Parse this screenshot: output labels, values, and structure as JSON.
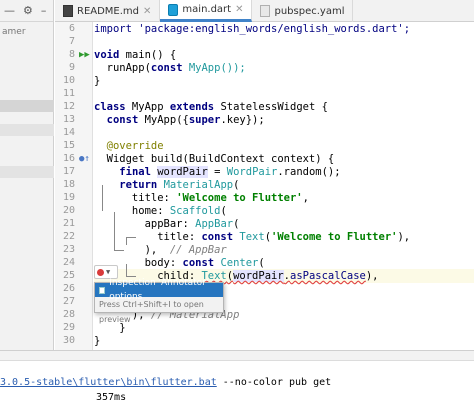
{
  "project_panel": {
    "toolbar_icons": [
      "collapse-icon",
      "gear-icon",
      "minimize-icon"
    ],
    "path_text": "amer"
  },
  "tabs": [
    {
      "label": "README.md",
      "icon": "markdown-file-icon",
      "active": false
    },
    {
      "label": "main.dart",
      "icon": "dart-file-icon",
      "active": true
    },
    {
      "label": "pubspec.yaml",
      "icon": "yaml-file-icon",
      "active": false
    }
  ],
  "gutter": {
    "line_numbers": [
      "6",
      "7",
      "8",
      "9",
      "10",
      "11",
      "12",
      "13",
      "14",
      "15",
      "16",
      "17",
      "18",
      "19",
      "20",
      "21",
      "22",
      "23",
      "24",
      "25",
      "26",
      "27",
      "28",
      "29",
      "30"
    ]
  },
  "code": {
    "l6": "import 'package:english_words/english_words.dart';",
    "l8a": "void",
    "l8b": " main() {",
    "l9a": "  runApp(",
    "l9b": "const",
    "l9c": " MyApp());",
    "l10": "}",
    "l12a": "class",
    "l12b": " MyApp ",
    "l12c": "extends",
    "l12d": " StatelessWidget {",
    "l13a": "  ",
    "l13b": "const",
    "l13c": " MyApp({",
    "l13d": "super",
    "l13e": ".key});",
    "l15": "  @override",
    "l16": "  Widget build(BuildContext context) {",
    "l17a": "    ",
    "l17b": "final",
    "l17c": " ",
    "l17d": "wordPair",
    "l17e": " = ",
    "l17f": "WordPair",
    "l17g": ".random();",
    "l18a": "    ",
    "l18b": "return",
    "l18c": " ",
    "l18d": "MaterialApp",
    "l18e": "(",
    "l19a": "      title: ",
    "l19b": "'Welcome to Flutter'",
    "l19c": ",",
    "l20a": "      home: ",
    "l20b": "Scaffold",
    "l20c": "(",
    "l21a": "        appBar: ",
    "l21b": "AppBar",
    "l21c": "(",
    "l22a": "          title: ",
    "l22b": "const",
    "l22c": " ",
    "l22d": "Text",
    "l22e": "(",
    "l22f": "'Welcome to Flutter'",
    "l22g": "),",
    "l23a": "        ),",
    "l23b": "  // AppBar",
    "l24a": "        body: ",
    "l24b": "const",
    "l24c": " ",
    "l24d": "Center",
    "l24e": "(",
    "l25a": "          child: ",
    "l25b": "Text",
    "l25c": "(",
    "l25d": "wordPair",
    "l25e": ".",
    "l25f": "asPascalCase",
    "l25g": "),",
    "l28a": "      ),",
    "l28b": " // MaterialApp",
    "l29": "    }",
    "l30": "}"
  },
  "intention": {
    "bulb_icon": "bulb-error-icon",
    "option_label": "Inspection 'Annotator' options",
    "hint": "Press Ctrl+Shift+I to open preview"
  },
  "run_panel": {
    "cmd_link": "3.0.5-stable\\flutter\\bin\\flutter.bat",
    "cmd_rest": " --no-color pub get",
    "time": "357ms"
  },
  "colors": {
    "accent": "#2675bf",
    "keyword": "#000080",
    "string": "#008000",
    "type": "#20999d",
    "annotation": "#808000",
    "error": "#d93a3a"
  }
}
